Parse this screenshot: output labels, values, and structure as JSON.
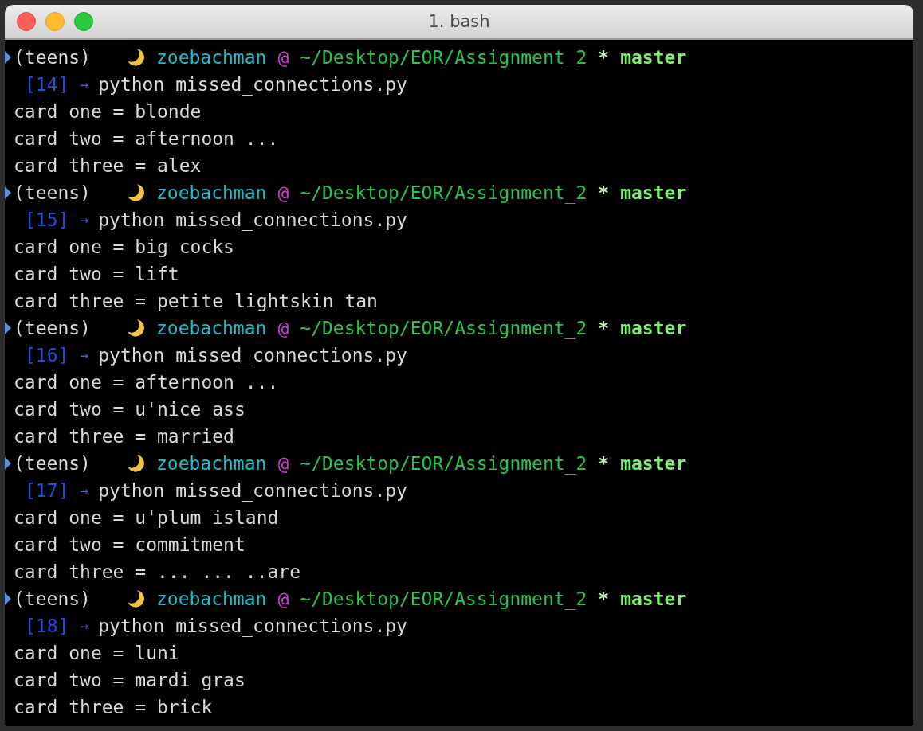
{
  "window": {
    "title": "1. bash"
  },
  "sessions": [
    {
      "env": "(teens)",
      "user": "zoebachman",
      "at": "@",
      "path": "~/Desktop/EOR/Assignment_2",
      "dirty": "*",
      "branch": "master",
      "number": "[14]",
      "arrow": "→",
      "command": "python missed_connections.py",
      "output": [
        "card one = blonde",
        "card two = afternoon ...",
        "card three = alex"
      ]
    },
    {
      "env": "(teens)",
      "user": "zoebachman",
      "at": "@",
      "path": "~/Desktop/EOR/Assignment_2",
      "dirty": "*",
      "branch": "master",
      "number": "[15]",
      "arrow": "→",
      "command": "python missed_connections.py",
      "output": [
        "card one = big cocks",
        "card two = lift",
        "card three = petite lightskin tan"
      ]
    },
    {
      "env": "(teens)",
      "user": "zoebachman",
      "at": "@",
      "path": "~/Desktop/EOR/Assignment_2",
      "dirty": "*",
      "branch": "master",
      "number": "[16]",
      "arrow": "→",
      "command": "python missed_connections.py",
      "output": [
        "card one = afternoon ...",
        "card two = u'nice ass",
        "card three = married"
      ]
    },
    {
      "env": "(teens)",
      "user": "zoebachman",
      "at": "@",
      "path": "~/Desktop/EOR/Assignment_2",
      "dirty": "*",
      "branch": "master",
      "number": "[17]",
      "arrow": "→",
      "command": "python missed_connections.py",
      "output": [
        "card one = u'plum island",
        "card two = commitment",
        "card three = ... ... ..are"
      ]
    },
    {
      "env": "(teens)",
      "user": "zoebachman",
      "at": "@",
      "path": "~/Desktop/EOR/Assignment_2",
      "dirty": "*",
      "branch": "master",
      "number": "[18]",
      "arrow": "→",
      "command": "python missed_connections.py",
      "output": [
        "card one = luni",
        "card two = mardi gras",
        "card three = brick"
      ]
    }
  ]
}
